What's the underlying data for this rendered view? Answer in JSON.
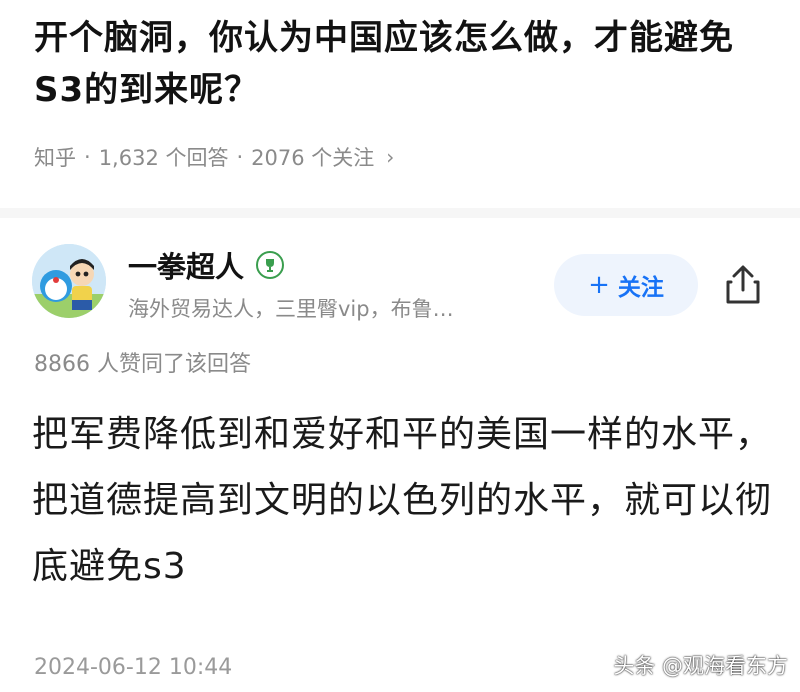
{
  "question": {
    "title": "开个脑洞，你认为中国应该怎么做，才能避免S3的到来呢？"
  },
  "meta": {
    "source": "知乎",
    "separator": "·",
    "answers": "1,632 个回答",
    "follows": "2076 个关注",
    "chevron": "›"
  },
  "author": {
    "name": "一拳超人",
    "badge_icon": "trophy-icon",
    "description": "海外贸易达人，三里臀vip，布鲁…",
    "avatar_icon": "cartoon-avatar"
  },
  "actions": {
    "follow_label": "关注",
    "follow_plus": "+",
    "share_icon": "share-icon"
  },
  "answer": {
    "upvotes": "8866 人赞同了该回答",
    "content": "把军费降低到和爱好和平的美国一样的水平，把道德提高到文明的以色列的水平，就可以彻底避免s3",
    "date": "2024-06-12 10:44"
  },
  "watermark": "头条 @观海看东方",
  "colors": {
    "accent": "#1772f6",
    "follow_bg": "#eef4fd",
    "muted": "#8a8a8a"
  }
}
